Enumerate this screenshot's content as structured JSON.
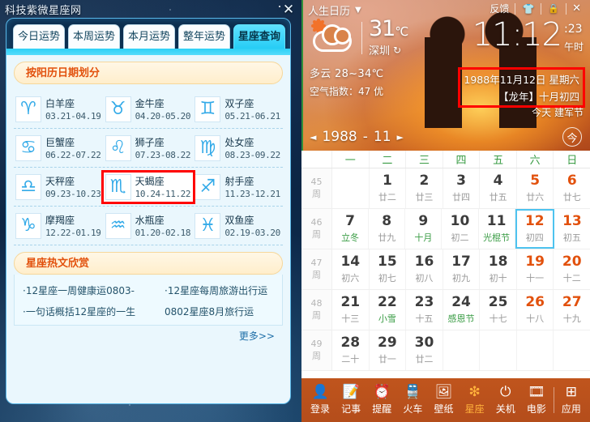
{
  "left": {
    "window_title": "科技紫微星座网",
    "close_icon": "✕",
    "tabs": [
      {
        "label": "今日运势",
        "active": false
      },
      {
        "label": "本周运势",
        "active": false
      },
      {
        "label": "本月运势",
        "active": false
      },
      {
        "label": "整年运势",
        "active": false
      },
      {
        "label": "星座查询",
        "active": true
      }
    ],
    "section_title": "按阳历日期划分",
    "zodiacs": [
      {
        "glyph": "♈",
        "name": "白羊座",
        "date": "03.21-04.19",
        "selected": false
      },
      {
        "glyph": "♉",
        "name": "金牛座",
        "date": "04.20-05.20",
        "selected": false
      },
      {
        "glyph": "♊",
        "name": "双子座",
        "date": "05.21-06.21",
        "selected": false
      },
      {
        "glyph": "♋",
        "name": "巨蟹座",
        "date": "06.22-07.22",
        "selected": false
      },
      {
        "glyph": "♌",
        "name": "狮子座",
        "date": "07.23-08.22",
        "selected": false
      },
      {
        "glyph": "♍",
        "name": "处女座",
        "date": "08.23-09.22",
        "selected": false
      },
      {
        "glyph": "♎",
        "name": "天秤座",
        "date": "09.23-10.23",
        "selected": false
      },
      {
        "glyph": "♏",
        "name": "天蝎座",
        "date": "10.24-11.22",
        "selected": true
      },
      {
        "glyph": "♐",
        "name": "射手座",
        "date": "11.23-12.21",
        "selected": false
      },
      {
        "glyph": "♑",
        "name": "摩羯座",
        "date": "12.22-01.19",
        "selected": false
      },
      {
        "glyph": "♒",
        "name": "水瓶座",
        "date": "01.20-02.18",
        "selected": false
      },
      {
        "glyph": "♓",
        "name": "双鱼座",
        "date": "02.19-03.20",
        "selected": false
      }
    ],
    "hot_title": "星座热文欣赏",
    "hot_links": [
      [
        "·12星座一周健康运0803-",
        "·12星座每周旅游出行运"
      ],
      [
        "·一句话概括12星座的一生",
        "0802星座8月旅行运"
      ]
    ],
    "more_label": "更多>>"
  },
  "right": {
    "titlebar": {
      "app_name": "人生日历",
      "menu_icon": "▼",
      "feedback_label": "反馈",
      "skin_icon": "👕",
      "lock_icon": "🔒",
      "close_icon": "✕"
    },
    "weather": {
      "icon": "partly-cloudy-icon",
      "temperature": "31",
      "unit": "℃",
      "city": "深圳",
      "refresh_icon": "↻",
      "condition_range": "多云 28~34℃",
      "air_quality": "空气指数：47 优"
    },
    "clock": {
      "time": "11:12",
      "seconds": "23",
      "sep": ":",
      "shichen": "午时"
    },
    "date_box": {
      "line1": "1988年11月12日  星期六",
      "line2": "【龙年】十月初四"
    },
    "today_line": "今天 建军节",
    "monthbar": {
      "prev_icon": "◄",
      "next_icon": "►",
      "year": "1988",
      "dash": "-",
      "month": "11",
      "today_label": "今"
    },
    "weekdays": [
      "",
      "一",
      "二",
      "三",
      "四",
      "五",
      "六",
      "日"
    ],
    "weeks": [
      {
        "wk_num": "45",
        "wk_label": "周",
        "days": [
          {
            "num": "",
            "lunar": "",
            "empty": true
          },
          {
            "num": "1",
            "lunar": "廿二"
          },
          {
            "num": "2",
            "lunar": "廿三"
          },
          {
            "num": "3",
            "lunar": "廿四"
          },
          {
            "num": "4",
            "lunar": "廿五"
          },
          {
            "num": "5",
            "lunar": "廿六",
            "weekend": true
          },
          {
            "num": "6",
            "lunar": "廿七",
            "weekend": true
          }
        ]
      },
      {
        "wk_num": "46",
        "wk_label": "周",
        "days": [
          {
            "num": "7",
            "lunar": "立冬",
            "fest": true
          },
          {
            "num": "8",
            "lunar": "廿九"
          },
          {
            "num": "9",
            "lunar": "十月",
            "fest": true
          },
          {
            "num": "10",
            "lunar": "初二"
          },
          {
            "num": "11",
            "lunar": "光棍节",
            "fest": true
          },
          {
            "num": "12",
            "lunar": "初四",
            "weekend": true,
            "selected": true
          },
          {
            "num": "13",
            "lunar": "初五",
            "weekend": true
          }
        ]
      },
      {
        "wk_num": "47",
        "wk_label": "周",
        "days": [
          {
            "num": "14",
            "lunar": "初六"
          },
          {
            "num": "15",
            "lunar": "初七"
          },
          {
            "num": "16",
            "lunar": "初八"
          },
          {
            "num": "17",
            "lunar": "初九"
          },
          {
            "num": "18",
            "lunar": "初十"
          },
          {
            "num": "19",
            "lunar": "十一",
            "weekend": true
          },
          {
            "num": "20",
            "lunar": "十二",
            "weekend": true
          }
        ]
      },
      {
        "wk_num": "48",
        "wk_label": "周",
        "days": [
          {
            "num": "21",
            "lunar": "十三"
          },
          {
            "num": "22",
            "lunar": "小雪",
            "fest": true
          },
          {
            "num": "23",
            "lunar": "十五"
          },
          {
            "num": "24",
            "lunar": "感恩节",
            "fest": true
          },
          {
            "num": "25",
            "lunar": "十七"
          },
          {
            "num": "26",
            "lunar": "十八",
            "weekend": true
          },
          {
            "num": "27",
            "lunar": "十九",
            "weekend": true
          }
        ]
      },
      {
        "wk_num": "49",
        "wk_label": "周",
        "days": [
          {
            "num": "28",
            "lunar": "二十"
          },
          {
            "num": "29",
            "lunar": "廿一"
          },
          {
            "num": "30",
            "lunar": "廿二"
          },
          {
            "num": "",
            "lunar": "",
            "empty": true
          },
          {
            "num": "",
            "lunar": "",
            "empty": true
          },
          {
            "num": "",
            "lunar": "",
            "empty": true
          },
          {
            "num": "",
            "lunar": "",
            "empty": true
          }
        ]
      }
    ],
    "tray": [
      {
        "icon": "👤",
        "label": "登录",
        "name": "login",
        "active": false
      },
      {
        "icon": "📝",
        "label": "记事",
        "name": "notes",
        "active": false
      },
      {
        "icon": "⏰",
        "label": "提醒",
        "name": "reminder",
        "active": false
      },
      {
        "icon": "🚆",
        "label": "火车",
        "name": "train",
        "active": false
      },
      {
        "icon": "🖼",
        "label": "壁纸",
        "name": "wallpaper",
        "active": false
      },
      {
        "icon": "❇",
        "label": "星座",
        "name": "zodiac",
        "active": true
      },
      {
        "icon": "⏻",
        "label": "关机",
        "name": "shutdown",
        "active": false
      },
      {
        "icon": "🎞",
        "label": "电影",
        "name": "movie",
        "active": false
      },
      {
        "icon": "⊞",
        "label": "应用",
        "name": "apps",
        "active": false
      }
    ]
  },
  "colors": {
    "accent_cyan": "#2dd0f6",
    "accent_orange": "#e2510d",
    "tray_bg": "#b44d1b",
    "festival_green": "#3a9c45",
    "highlight_red": "#ff0000"
  }
}
